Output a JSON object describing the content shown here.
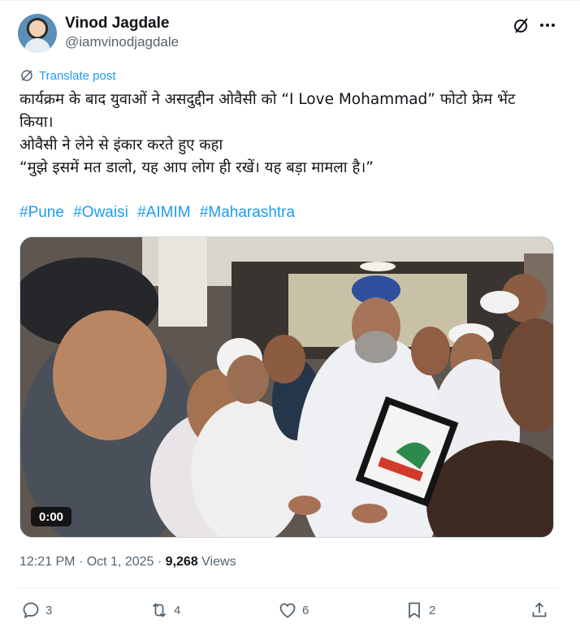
{
  "author": {
    "name": "Vinod Jagdale",
    "handle": "@iamvinodjagdale"
  },
  "translate_label": "Translate post",
  "post_lines": [
    "कार्यक्रम के बाद युवाओं ने असदुद्दीन ओवैसी को “I Love Mohammad” फोटो फ्रेम भेंट",
    "किया।",
    "ओवैसी ने लेने से इंकार करते हुए कहा",
    "“मुझे इसमें मत डालो, यह आप लोग ही रखें। यह बड़ा मामला है।”"
  ],
  "hashtags": [
    "#Pune",
    "#Owaisi",
    "#AIMIM",
    "#Maharashtra"
  ],
  "video": {
    "duration": "0:00"
  },
  "meta": {
    "time": "12:21 PM",
    "date": "Oct 1, 2025",
    "views_count": "9,268",
    "views_label": "Views"
  },
  "actions": {
    "replies": "3",
    "reposts": "4",
    "likes": "6",
    "bookmarks": "2"
  },
  "colors": {
    "accent": "#1d9bf0",
    "text": "#0f1419",
    "secondary": "#536471"
  }
}
